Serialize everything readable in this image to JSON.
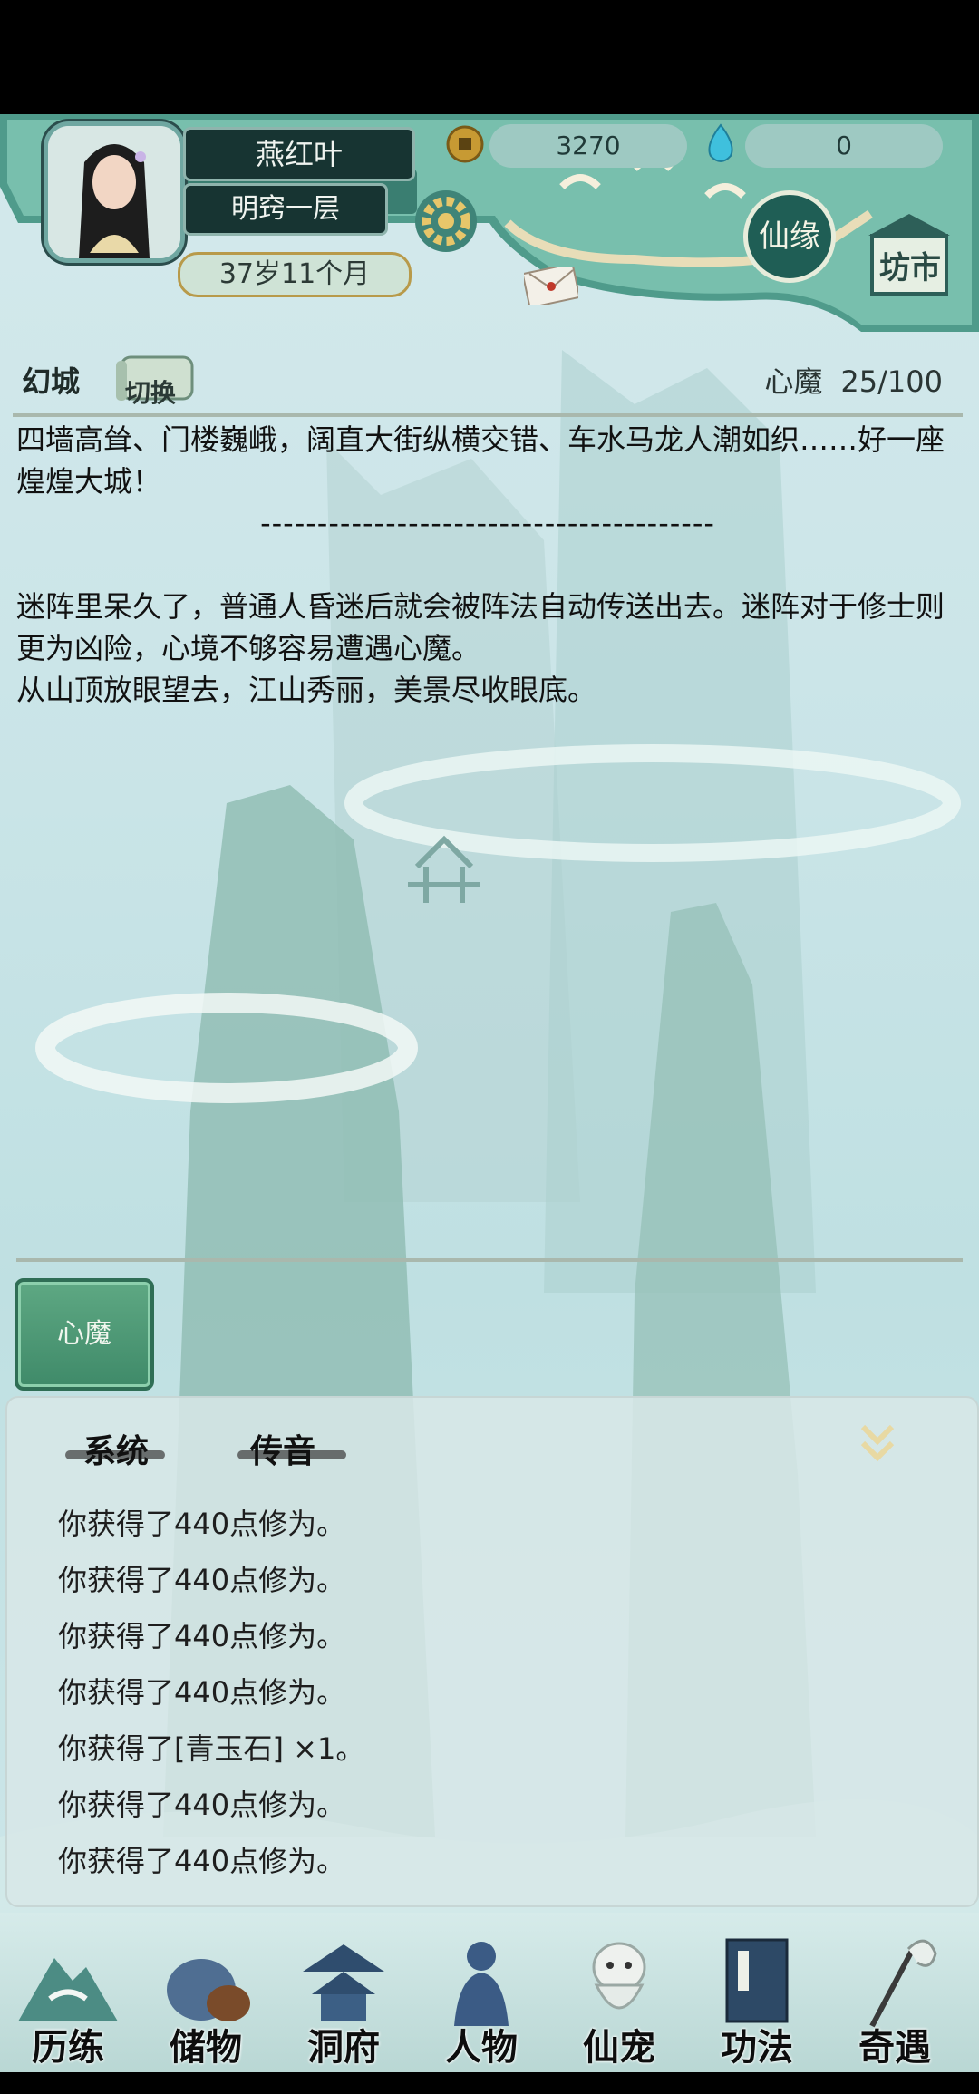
{
  "player": {
    "name": "燕红叶",
    "realm": "明窍一层",
    "age": "37岁11个月"
  },
  "resources": {
    "coins": "3270",
    "gems": "0"
  },
  "header_buttons": {
    "xianyuan": "仙缘",
    "fangshi": "坊市"
  },
  "location": {
    "name": "幻城",
    "switch_label": "切换"
  },
  "xinmo": {
    "label": "心魔",
    "value": "25/100"
  },
  "story": [
    "四墙高耸、门楼巍峨，阔直大街纵横交错、车水马龙人潮如织……好一座煌煌大城！",
    "----------------------------------------",
    "",
    "迷阵里呆久了，普通人昏迷后就会被阵法自动传送出去。迷阵对于修士则更为凶险，心境不够容易遭遇心魔。",
    "从山顶放眼望去，江山秀丽，美景尽收眼底。"
  ],
  "action_button": "心魔",
  "log_tabs": [
    "系统",
    "传音"
  ],
  "log": [
    "你获得了440点修为。",
    "你获得了440点修为。",
    "你获得了440点修为。",
    "你获得了440点修为。",
    "你获得了[青玉石] ×1。",
    "你获得了440点修为。",
    "你获得了440点修为。"
  ],
  "nav": [
    {
      "label": "历练",
      "icon": "mountain-icon"
    },
    {
      "label": "储物",
      "icon": "bag-icon"
    },
    {
      "label": "洞府",
      "icon": "pavilion-icon"
    },
    {
      "label": "人物",
      "icon": "person-icon"
    },
    {
      "label": "仙宠",
      "icon": "pet-icon"
    },
    {
      "label": "功法",
      "icon": "book-icon"
    },
    {
      "label": "奇遇",
      "icon": "staff-icon"
    }
  ],
  "colors": {
    "accent": "#3f8a69",
    "panel": "#173432",
    "background": "#c9e4e7"
  }
}
